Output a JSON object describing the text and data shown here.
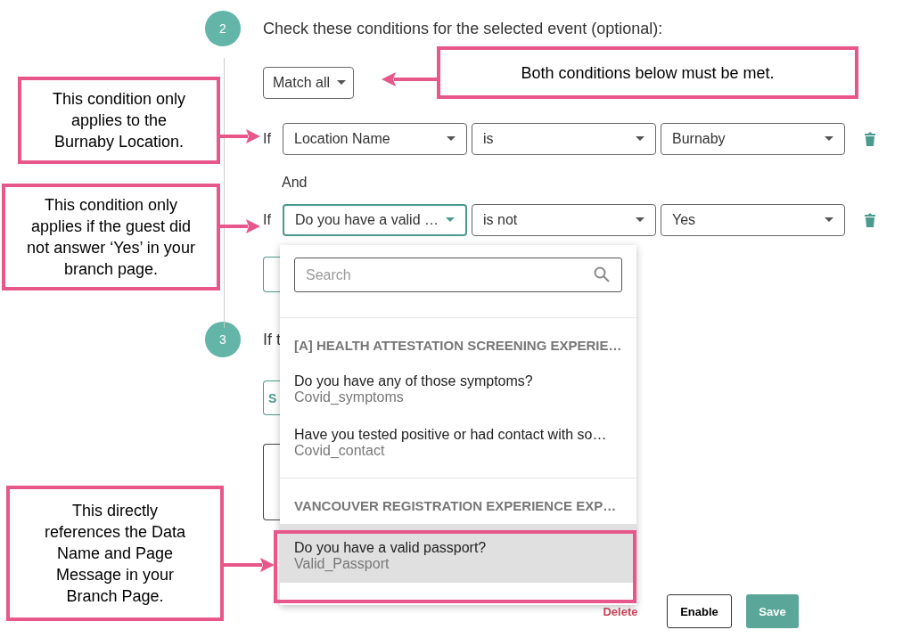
{
  "step": {
    "number": "2",
    "title": "Check these conditions for the selected event (optional):",
    "match": "Match all",
    "conditions": [
      {
        "prefix": "If",
        "field": "Location Name",
        "operator": "is",
        "value": "Burnaby",
        "focused": false
      },
      {
        "prefix": "If",
        "field": "Do you have a valid …",
        "operator": "is not",
        "value": "Yes",
        "focused": true
      }
    ],
    "connector": "And"
  },
  "dropdown": {
    "placeholder": "Search",
    "groups": [
      {
        "header": "[A] HEALTH ATTESTATION SCREENING EXPERIE…",
        "items": [
          {
            "question": "Do you have any of those symptoms?",
            "data_name": "Covid_symptoms",
            "selected": false
          },
          {
            "question": "Have you tested positive or had contact with so…",
            "data_name": "Covid_contact",
            "selected": false
          }
        ]
      },
      {
        "header": "VANCOUVER REGISTRATION EXPERIENCE EXP…",
        "items": [
          {
            "question": "Do you have a valid passport?",
            "data_name": "Valid_Passport",
            "selected": true
          }
        ]
      }
    ]
  },
  "next_step": {
    "number": "3",
    "title": "If t",
    "button": "S"
  },
  "footer": {
    "delete": "Delete",
    "enable": "Enable",
    "save": "Save"
  },
  "annotations": [
    {
      "text": "Both conditions below must be met."
    },
    {
      "text": "This condition only applies to the Burnaby Location."
    },
    {
      "text": "This condition only applies if the guest did not answer ‘Yes’ in your branch page."
    },
    {
      "text": "This directly references the Data Name and Page Message in your Branch Page."
    }
  ]
}
